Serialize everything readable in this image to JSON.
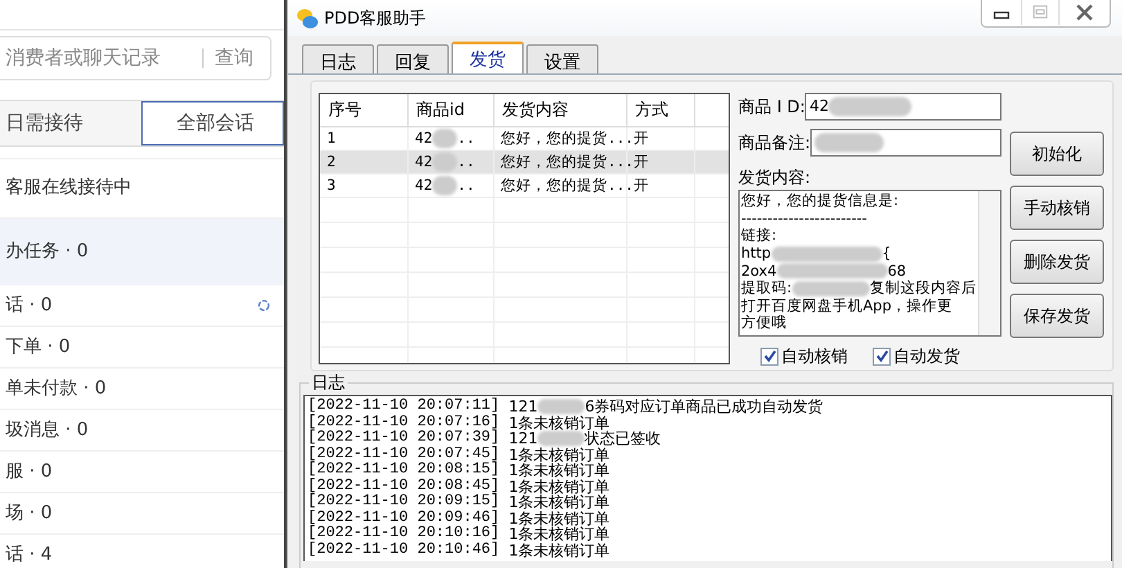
{
  "background_app": {
    "search": {
      "placeholder": "消费者或聊天记录",
      "button": "查询"
    },
    "tabs": [
      {
        "label": "日需接待",
        "selected": false
      },
      {
        "label": "全部会话",
        "selected": true
      }
    ],
    "status": "客服在线接待中",
    "items": [
      {
        "label": "办任务 · 0",
        "selected": true
      },
      {
        "label": "话 · 0",
        "selected": false
      },
      {
        "label": "下单 · 0",
        "selected": false
      },
      {
        "label": "单未付款 · 0",
        "selected": false
      },
      {
        "label": "圾消息 · 0",
        "selected": false
      },
      {
        "label": "服 · 0",
        "selected": false
      },
      {
        "label": "场 · 0",
        "selected": false
      },
      {
        "label": "话 · 4",
        "selected": false
      }
    ]
  },
  "window": {
    "title": "PDD客服助手",
    "tabs": [
      {
        "label": "日志",
        "selected": false
      },
      {
        "label": "回复",
        "selected": false
      },
      {
        "label": "发货",
        "selected": true
      },
      {
        "label": "设置",
        "selected": false
      }
    ],
    "table": {
      "columns": [
        "序号",
        "商品id",
        "发货内容",
        "方式"
      ],
      "rows": [
        {
          "index": "1",
          "product_id": "42",
          "product_id_end": "..",
          "content": "您好，您的提货...",
          "mode": "开",
          "selected": false
        },
        {
          "index": "2",
          "product_id": "42",
          "product_id_end": "..",
          "content": "您好，您的提货...",
          "mode": "开",
          "selected": true
        },
        {
          "index": "3",
          "product_id": "42",
          "product_id_end": "..",
          "content": "您好，您的提货...",
          "mode": "开",
          "selected": false
        }
      ]
    },
    "form": {
      "id_label": "商品 I D:",
      "id_value": "42",
      "note_label": "商品备注:",
      "content_label": "发货内容:",
      "content_lines": [
        [
          {
            "text": "您好，您的提货信息是:"
          }
        ],
        [
          {
            "text": "------------------------"
          }
        ],
        [
          {
            "text": "链接:"
          }
        ],
        [
          {
            "text": "http"
          },
          {
            "kind": "redacted"
          },
          {
            "text": "{"
          }
        ],
        [
          {
            "text": "2ox4"
          },
          {
            "kind": "redacted"
          },
          {
            "text": "68"
          }
        ],
        [
          {
            "text": "提取码:"
          },
          {
            "kind": "redacted"
          },
          {
            "text": "复制这段内容后"
          }
        ],
        [
          {
            "text": "打开百度网盘手机App，操作更"
          }
        ],
        [
          {
            "text": "方便哦"
          }
        ]
      ],
      "checkboxes": [
        {
          "label": "自动核销",
          "checked": true
        },
        {
          "label": "自动发货",
          "checked": true
        }
      ]
    },
    "buttons": [
      "初始化",
      "手动核销",
      "删除发货",
      "保存发货"
    ],
    "log": {
      "title": "日志",
      "lines": [
        {
          "time": "[2022-11-10 20:07:11]",
          "parts": [
            {
              "text": "121"
            },
            {
              "kind": "redacted"
            },
            {
              "text": "6券码对应订单商品已成功自动发货"
            }
          ]
        },
        {
          "time": "[2022-11-10 20:07:16]",
          "parts": [
            {
              "text": "1条未核销订单"
            }
          ]
        },
        {
          "time": "[2022-11-10 20:07:39]",
          "parts": [
            {
              "text": "121"
            },
            {
              "kind": "redacted"
            },
            {
              "text": "状态已签收"
            }
          ]
        },
        {
          "time": "[2022-11-10 20:07:45]",
          "parts": [
            {
              "text": "1条未核销订单"
            }
          ]
        },
        {
          "time": "[2022-11-10 20:08:15]",
          "parts": [
            {
              "text": "1条未核销订单"
            }
          ]
        },
        {
          "time": "[2022-11-10 20:08:45]",
          "parts": [
            {
              "text": "1条未核销订单"
            }
          ]
        },
        {
          "time": "[2022-11-10 20:09:15]",
          "parts": [
            {
              "text": "1条未核销订单"
            }
          ]
        },
        {
          "time": "[2022-11-10 20:09:46]",
          "parts": [
            {
              "text": "1条未核销订单"
            }
          ]
        },
        {
          "time": "[2022-11-10 20:10:16]",
          "parts": [
            {
              "text": "1条未核销订单"
            }
          ]
        },
        {
          "time": "[2022-11-10 20:10:46]",
          "parts": [
            {
              "text": "1条未核销订单"
            }
          ]
        }
      ]
    }
  }
}
